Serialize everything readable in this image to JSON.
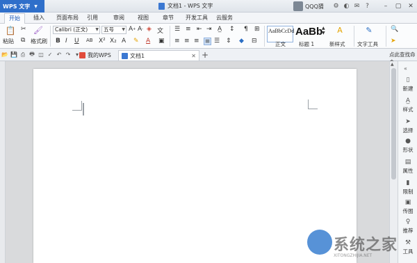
{
  "titlebar": {
    "app_name": "WPS 文字",
    "doc_title": "文档1 - WPS 文字",
    "user": "QQQ猜",
    "icons": [
      "settings-icon",
      "skin-icon",
      "feedback-icon",
      "help-icon"
    ]
  },
  "menu": {
    "tabs": [
      "开始",
      "插入",
      "页面布局",
      "引用",
      "审阅",
      "视图",
      "章节",
      "开发工具",
      "云服务"
    ],
    "active": "开始"
  },
  "ribbon": {
    "paste": "粘贴",
    "format_painter": "格式刷",
    "font_name": "Calibri (正文)",
    "font_size": "五号",
    "styles": [
      {
        "sample": "AaBbCcDd",
        "label": "正文"
      },
      {
        "sample": "AaBb",
        "label": "标题 1"
      }
    ],
    "new_style": "新样式",
    "text_tools": "文字工具"
  },
  "docbar": {
    "tabs": [
      {
        "label": "我的WPS",
        "color": "#e14b3b"
      },
      {
        "label": "文档1",
        "color": "#3b78d2"
      }
    ],
    "help_search": "点此查找命令"
  },
  "taskpane": {
    "items": [
      {
        "label": "新建",
        "icon": "new-doc-icon"
      },
      {
        "label": "样式",
        "icon": "style-icon"
      },
      {
        "label": "选择",
        "icon": "select-icon"
      },
      {
        "label": "形状",
        "icon": "shape-icon"
      },
      {
        "label": "属性",
        "icon": "properties-icon"
      },
      {
        "label": "限制",
        "icon": "restrict-icon"
      },
      {
        "label": "传图",
        "icon": "upload-image-icon"
      },
      {
        "label": "推荐",
        "icon": "recommend-icon"
      },
      {
        "label": "工具",
        "icon": "tools-icon"
      }
    ]
  },
  "watermark": {
    "text": "系统之家",
    "url": "XITONGZHIJIA.NET"
  },
  "colors": {
    "app_blue": "#2f6fca",
    "active_tab_text": "#1b59b7"
  }
}
